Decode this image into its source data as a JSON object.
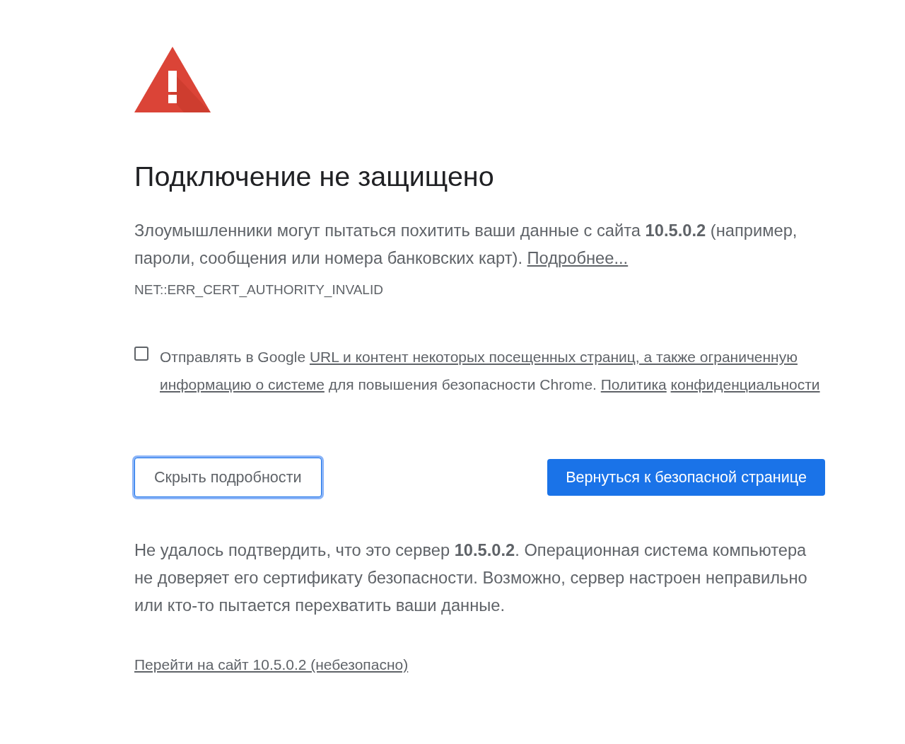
{
  "heading": "Подключение не защищено",
  "intro": {
    "text": "Злоумышленники могут пытаться похитить ваши данные с сайта **10.5.0.2** (например, пароли, сообщения или номера банковских карт).",
    "link": "Подробнее..."
  },
  "error_code": "NET::ERR_CERT_AUTHORITY_INVALID",
  "report_option": {
    "checked": false,
    "segments": [
      {
        "text": "Отправлять в Google",
        "kind": "text"
      },
      {
        "text": "URL и контент некоторых посещенных страниц, а также ограниченную",
        "kind": "link"
      },
      {
        "text": "информацию о системе",
        "kind": "link"
      },
      {
        "text": "для повышения безопасности Chrome.",
        "kind": "text"
      },
      {
        "text": "Политика",
        "kind": "link"
      },
      {
        "text": "конфиденциальности",
        "kind": "link"
      }
    ]
  },
  "buttons": [
    {
      "label": "Скрыть подробности",
      "kind": "secondary",
      "focused": true
    },
    {
      "label": "Вернуться к безопасной странице",
      "kind": "primary",
      "focused": false
    }
  ],
  "details": "Не удалось подтвердить, что это сервер **10.5.0.2**. Операционная система компьютера не доверяет его сертификату безопасности. Возможно, сервер настроен неправильно или кто-то пытается перехватить ваши данные.",
  "proceed_link": "Перейти на сайт 10.5.0.2 (небезопасно)"
}
